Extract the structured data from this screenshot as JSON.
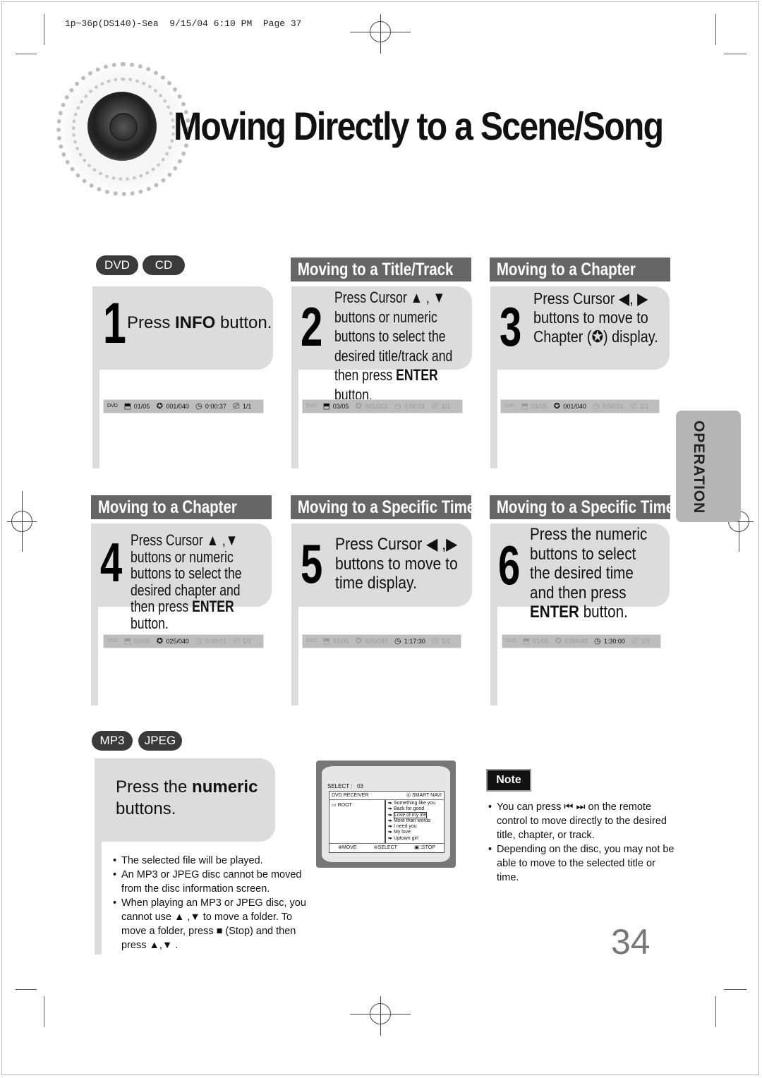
{
  "print_slug": {
    "file": "1p~36p(DS140)-Sea",
    "date": "9/15/04",
    "time": "6:10 PM",
    "page_label": "Page 37"
  },
  "title": "Moving Directly to a Scene/Song",
  "side_tab": "OPERATION",
  "disc_badges_top": [
    "DVD",
    "CD"
  ],
  "disc_badges_bottom": [
    "MP3",
    "JPEG"
  ],
  "sections": [
    {
      "header": "",
      "step": "1",
      "text_parts": [
        "Press ",
        "INFO",
        " button."
      ]
    },
    {
      "header": "Moving to a Title/Track",
      "step": "2",
      "text_parts": [
        "Press Cursor ▲ , ▼ buttons or numeric buttons to select the desired title/track and then press ",
        "ENTER",
        " button."
      ]
    },
    {
      "header": "Moving to a Chapter",
      "step": "3",
      "text_parts": [
        "Press Cursor ◀, ▶ buttons to move to Chapter (",
        "✪",
        ") display."
      ]
    },
    {
      "header": "Moving to a Chapter",
      "step": "4",
      "text_parts": [
        "Press Cursor ▲ ,▼ buttons or numeric buttons to select the desired chapter and then press ",
        "ENTER",
        " button."
      ]
    },
    {
      "header": "Moving to a Specific Time",
      "step": "5",
      "text_parts": [
        "Press Cursor ◀ ,▶ buttons to move to time display.",
        "",
        ""
      ]
    },
    {
      "header": "Moving to a Specific Time",
      "step": "6",
      "text_parts": [
        "Press the numeric buttons to select the desired time and then press ",
        "ENTER",
        " button."
      ]
    }
  ],
  "osd_displays": [
    {
      "disc": "DVD",
      "title": "01/05",
      "chapter": "001/040",
      "time": "0:00:37",
      "angle": "1/1",
      "active": "all"
    },
    {
      "disc": "DVD",
      "title": "03/05",
      "chapter": "001/002",
      "time": "0:00:01",
      "angle": "1/1",
      "active": "title"
    },
    {
      "disc": "DVD",
      "title": "01/05",
      "chapter": "001/040",
      "time": "0:00:01",
      "angle": "1/1",
      "active": "chapter"
    },
    {
      "disc": "DVD",
      "title": "01/05",
      "chapter": "025/040",
      "time": "0:00:01",
      "angle": "1/1",
      "active": "chapter"
    },
    {
      "disc": "DVD",
      "title": "01/05",
      "chapter": "025/040",
      "time": "1:17:30",
      "angle": "1/1",
      "active": "time"
    },
    {
      "disc": "DVD",
      "title": "01/05",
      "chapter": "028/040",
      "time": "1:30:00",
      "angle": "1/1",
      "active": "time"
    }
  ],
  "mp3_step": {
    "text_pre": "Press the ",
    "text_bold": "numeric",
    "text_post": "buttons.",
    "bullets": [
      "The selected file will be played.",
      "An MP3 or JPEG disc cannot be moved from the disc information screen.",
      "When playing an MP3 or JPEG disc, you cannot use ▲ ,▼  to move a folder. To move a folder, press ■ (Stop) and then press ▲,▼ ."
    ]
  },
  "tv_screen": {
    "select_label": "SELECT :",
    "select_value": "03",
    "window_title": "DVD RECEIVER",
    "window_brand": "◎ SMART NAVI",
    "root_label": "ROOT",
    "tracks": [
      "Something like you",
      "Back for good",
      "Love of my life",
      "More than words",
      "I need you",
      "My love",
      "Uptown girl"
    ],
    "highlighted_index": 2,
    "footer": [
      "MOVE",
      "SELECT",
      "STOP"
    ]
  },
  "note": {
    "label": "Note",
    "bullets": [
      "You can press ⏮ ⏭ on the remote control to move directly to the desired title, chapter, or track.",
      "Depending on the disc, you may not be able to move to the selected title or time."
    ]
  },
  "page_number": "34"
}
